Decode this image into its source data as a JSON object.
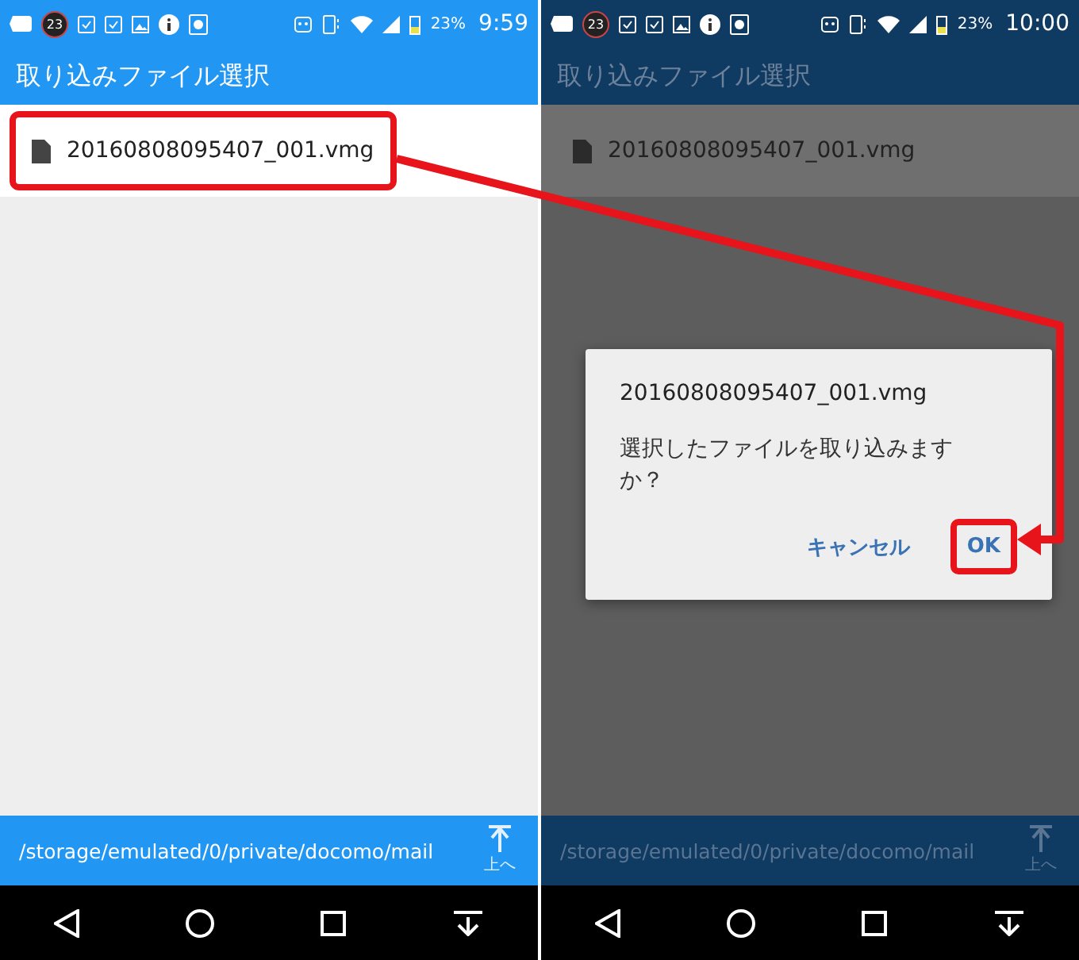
{
  "screens": [
    {
      "dimmed": false,
      "status_bar": {
        "badge": "23",
        "battery": "23%",
        "time": "9:59"
      },
      "title": "取り込みファイル選択",
      "files": [
        {
          "name": "20160808095407_001.vmg",
          "highlighted": true
        }
      ],
      "path": "/storage/emulated/0/private/docomo/mail",
      "up_label": "上へ"
    },
    {
      "dimmed": true,
      "status_bar": {
        "badge": "23",
        "battery": "23%",
        "time": "10:00"
      },
      "title": "取り込みファイル選択",
      "files": [
        {
          "name": "20160808095407_001.vmg",
          "highlighted": false
        }
      ],
      "path": "/storage/emulated/0/private/docomo/mail",
      "up_label": "上へ",
      "dialog": {
        "title": "20160808095407_001.vmg",
        "message": "選択したファイルを取り込みますか？",
        "buttons": [
          {
            "label": "キャンセル",
            "highlighted": false
          },
          {
            "label": "OK",
            "highlighted": true
          }
        ]
      }
    }
  ]
}
